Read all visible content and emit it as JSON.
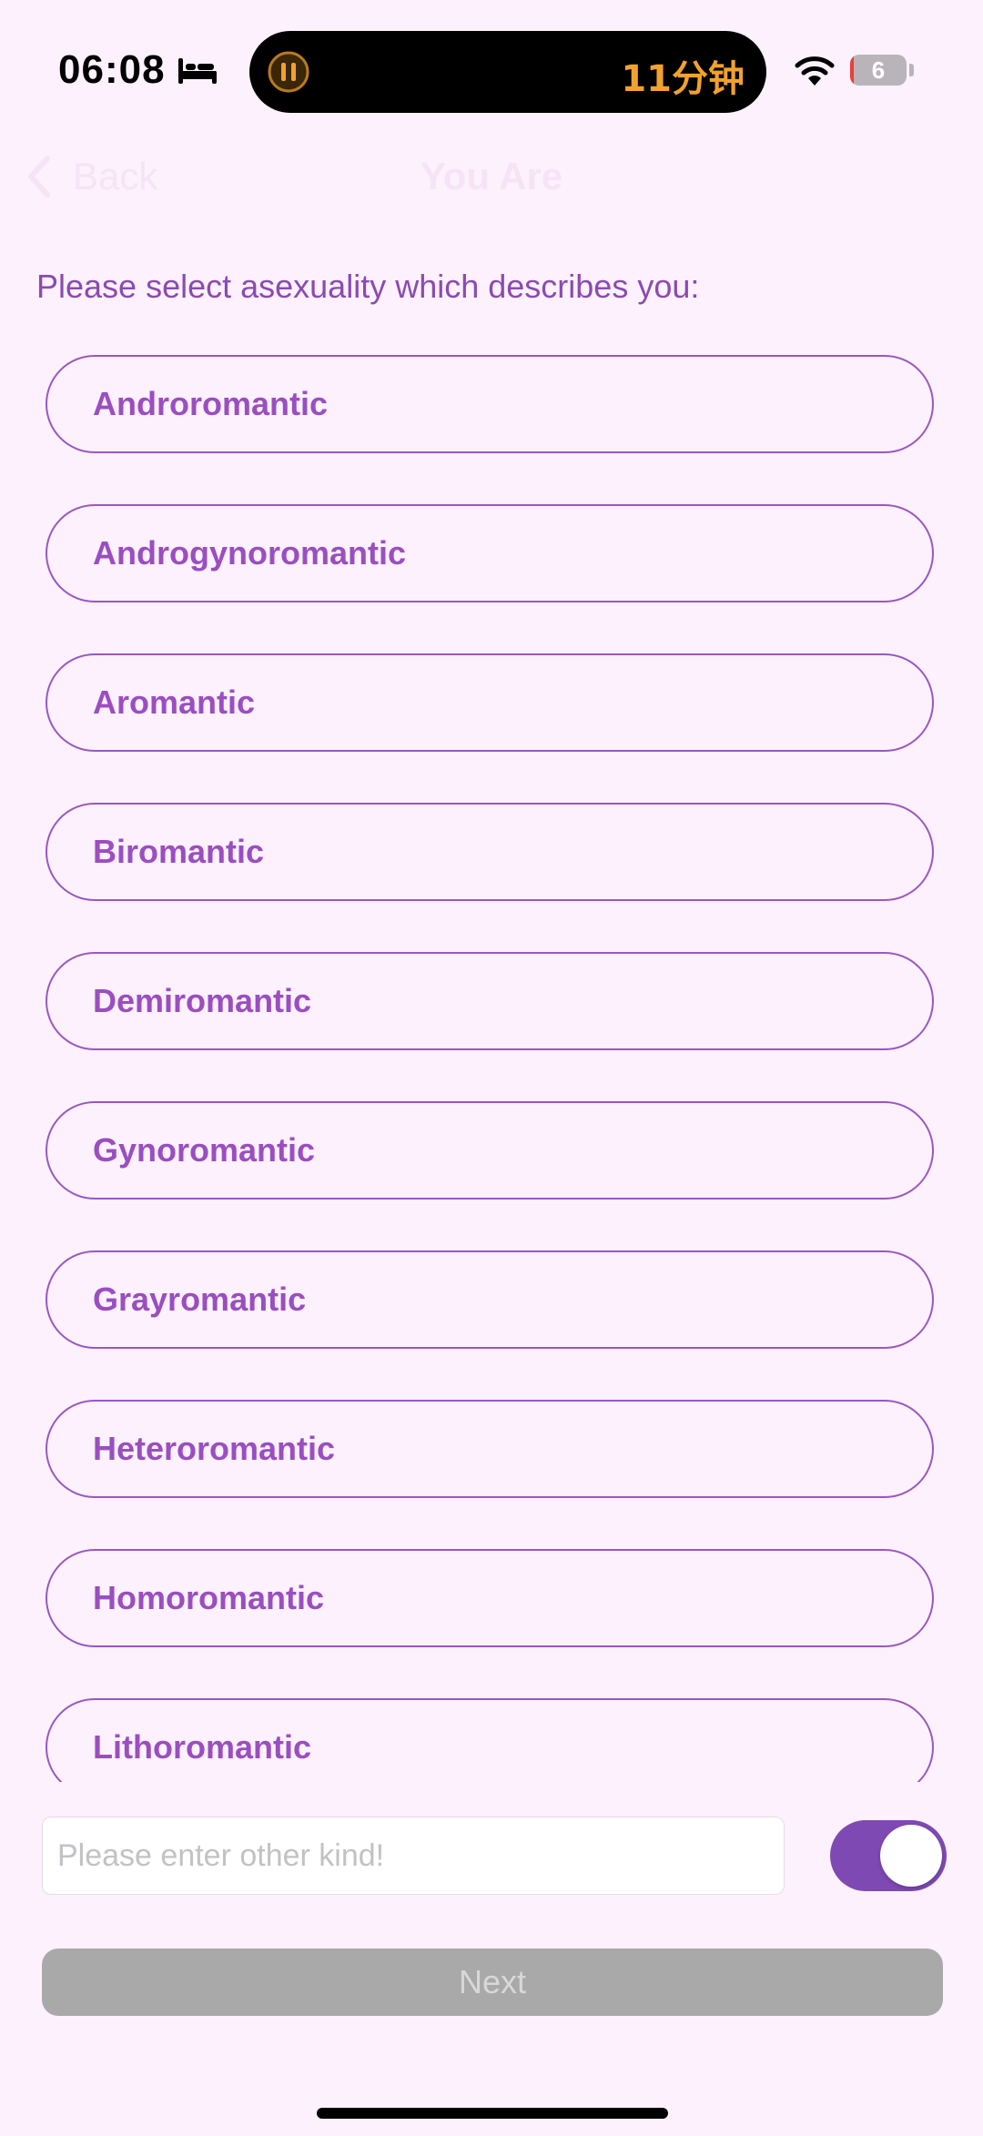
{
  "status_bar": {
    "time": "06:08",
    "live_activity_text": "11分钟",
    "battery_level": "6",
    "battery_fraction": 0.06
  },
  "nav": {
    "back_label": "Back",
    "title": "You Are"
  },
  "prompt": "Please select asexuality which describes you:",
  "options": [
    {
      "label": "Androromantic"
    },
    {
      "label": "Androgynoromantic"
    },
    {
      "label": "Aromantic"
    },
    {
      "label": "Biromantic"
    },
    {
      "label": "Demiromantic"
    },
    {
      "label": "Gynoromantic"
    },
    {
      "label": "Grayromantic"
    },
    {
      "label": "Heteroromantic"
    },
    {
      "label": "Homoromantic"
    },
    {
      "label": "Lithoromantic"
    }
  ],
  "other_input": {
    "value": "",
    "placeholder": "Please enter other kind!"
  },
  "other_toggle": {
    "on": true
  },
  "next_label": "Next",
  "colors": {
    "background": "#fdf1fd",
    "accent": "#9a4ec0",
    "toggle_on": "#7e49b3",
    "next_disabled": "#a9a9a9",
    "timer_orange": "#f2a12e"
  },
  "icons": {
    "status": [
      "bed-icon",
      "pause-icon",
      "wifi-icon",
      "battery-icon"
    ],
    "nav": [
      "chevron-left-icon"
    ]
  }
}
